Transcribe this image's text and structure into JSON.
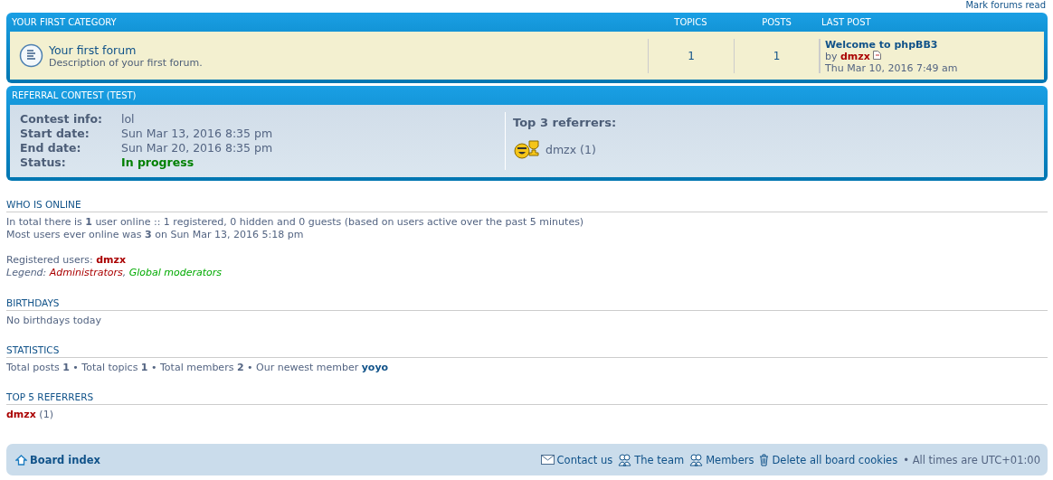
{
  "top_link": "Mark forums read",
  "category": {
    "title": "YOUR FIRST CATEGORY",
    "columns": [
      "TOPICS",
      "POSTS",
      "LAST POST"
    ],
    "forums": [
      {
        "name": "Your first forum",
        "description": "Description of your first forum.",
        "topics": "1",
        "posts": "1",
        "last_post": {
          "title": "Welcome to phpBB3",
          "by": "by",
          "author": "dmzx",
          "time": "Thu Mar 10, 2016 7:49 am"
        }
      }
    ]
  },
  "contest": {
    "title": "REFERRAL CONTEST (TEST)",
    "fields": [
      {
        "label": "Contest info:",
        "value": "lol",
        "kind": "plain"
      },
      {
        "label": "Start date:",
        "value": "Sun Mar 13, 2016 8:35 pm",
        "kind": "plain"
      },
      {
        "label": "End date:",
        "value": "Sun Mar 20, 2016 8:35 pm",
        "kind": "plain"
      },
      {
        "label": "Status:",
        "value": "In progress",
        "kind": "status"
      }
    ],
    "top_title": "Top 3 referrers:",
    "referrers": [
      {
        "name": "dmzx",
        "count": "(1)"
      }
    ]
  },
  "who_online": {
    "title": "WHO IS ONLINE",
    "lines": [
      "In total there is **1** user online :: 1 registered, 0 hidden and 0 guests (based on users active over the past 5 minutes)",
      "Most users ever online was **3** on Sun Mar 13, 2016 5:18 pm"
    ],
    "registered_label": "Registered users:",
    "registered_users": [
      {
        "name": "dmzx",
        "color": "#aa0000"
      }
    ],
    "legend_label": "Legend:",
    "legend_separator": ",",
    "legend": [
      {
        "name": "Administrators",
        "color": "#aa0000"
      },
      {
        "name": "Global moderators",
        "color": "#00aa00"
      }
    ]
  },
  "birthdays": {
    "title": "BIRTHDAYS",
    "text": "No birthdays today"
  },
  "statistics": {
    "title": "STATISTICS",
    "text": "Total posts **1** • Total topics **1** • Total members **2** • Our newest member",
    "newest_member": "yoyo"
  },
  "top_referrers": {
    "title": "TOP 5 REFERRERS",
    "items": [
      {
        "name": "dmzx",
        "color": "#aa0000",
        "count": "(1)"
      }
    ]
  },
  "footer": {
    "board_index": "Board index",
    "links": [
      {
        "label": "Contact us",
        "kind": "mail"
      },
      {
        "label": "The team",
        "kind": "team"
      },
      {
        "label": "Members",
        "kind": "team"
      },
      {
        "label": "Delete all board cookies",
        "kind": "trash"
      }
    ],
    "timezone": "• All times are UTC+01:00"
  }
}
